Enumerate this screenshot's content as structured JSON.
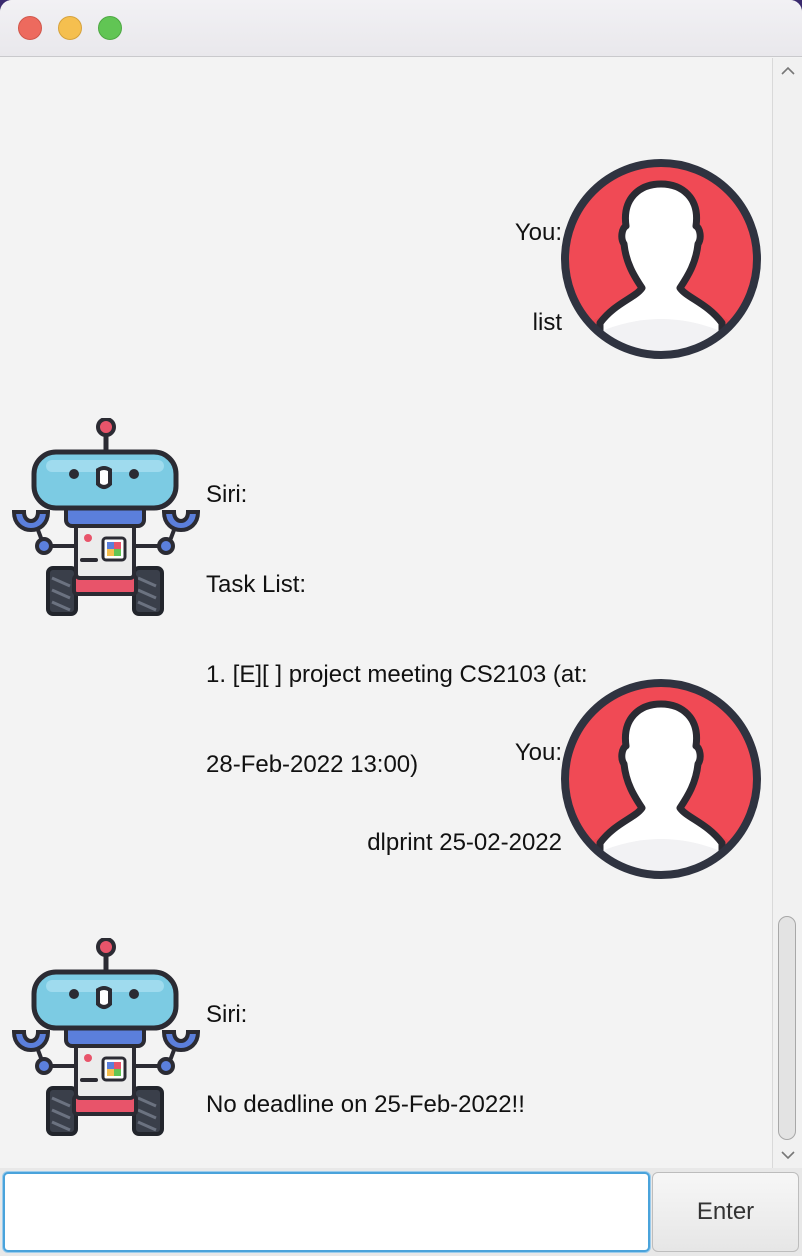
{
  "window": {
    "traffic_lights": [
      "close",
      "minimize",
      "maximize"
    ]
  },
  "dialog": [
    {
      "speaker": "bot",
      "lines": []
    },
    {
      "speaker": "user",
      "lines": [
        "You:",
        "list"
      ]
    },
    {
      "speaker": "bot",
      "lines": [
        "Siri:",
        "Task List:",
        "1. [E][ ] project meeting CS2103 (at:",
        "28-Feb-2022 13:00)"
      ]
    },
    {
      "speaker": "user",
      "lines": [
        "You:",
        "dlprint 25-02-2022"
      ]
    },
    {
      "speaker": "bot",
      "lines": [
        "Siri:",
        "No deadline on 25-Feb-2022!!"
      ]
    }
  ],
  "icons": {
    "scroll_up": "chevron-up-icon",
    "scroll_down": "chevron-down-icon",
    "bot_avatar": "robot-icon",
    "user_avatar": "user-silhouette-icon"
  },
  "colors": {
    "user_avatar_bg": "#f04a55",
    "bot_head": "#7ccbe3",
    "bot_body": "#5b7fdc",
    "bot_accent": "#e8546a",
    "input_focus": "#4aa3db"
  },
  "input": {
    "value": "",
    "placeholder": ""
  },
  "enter_button": {
    "label": "Enter"
  }
}
